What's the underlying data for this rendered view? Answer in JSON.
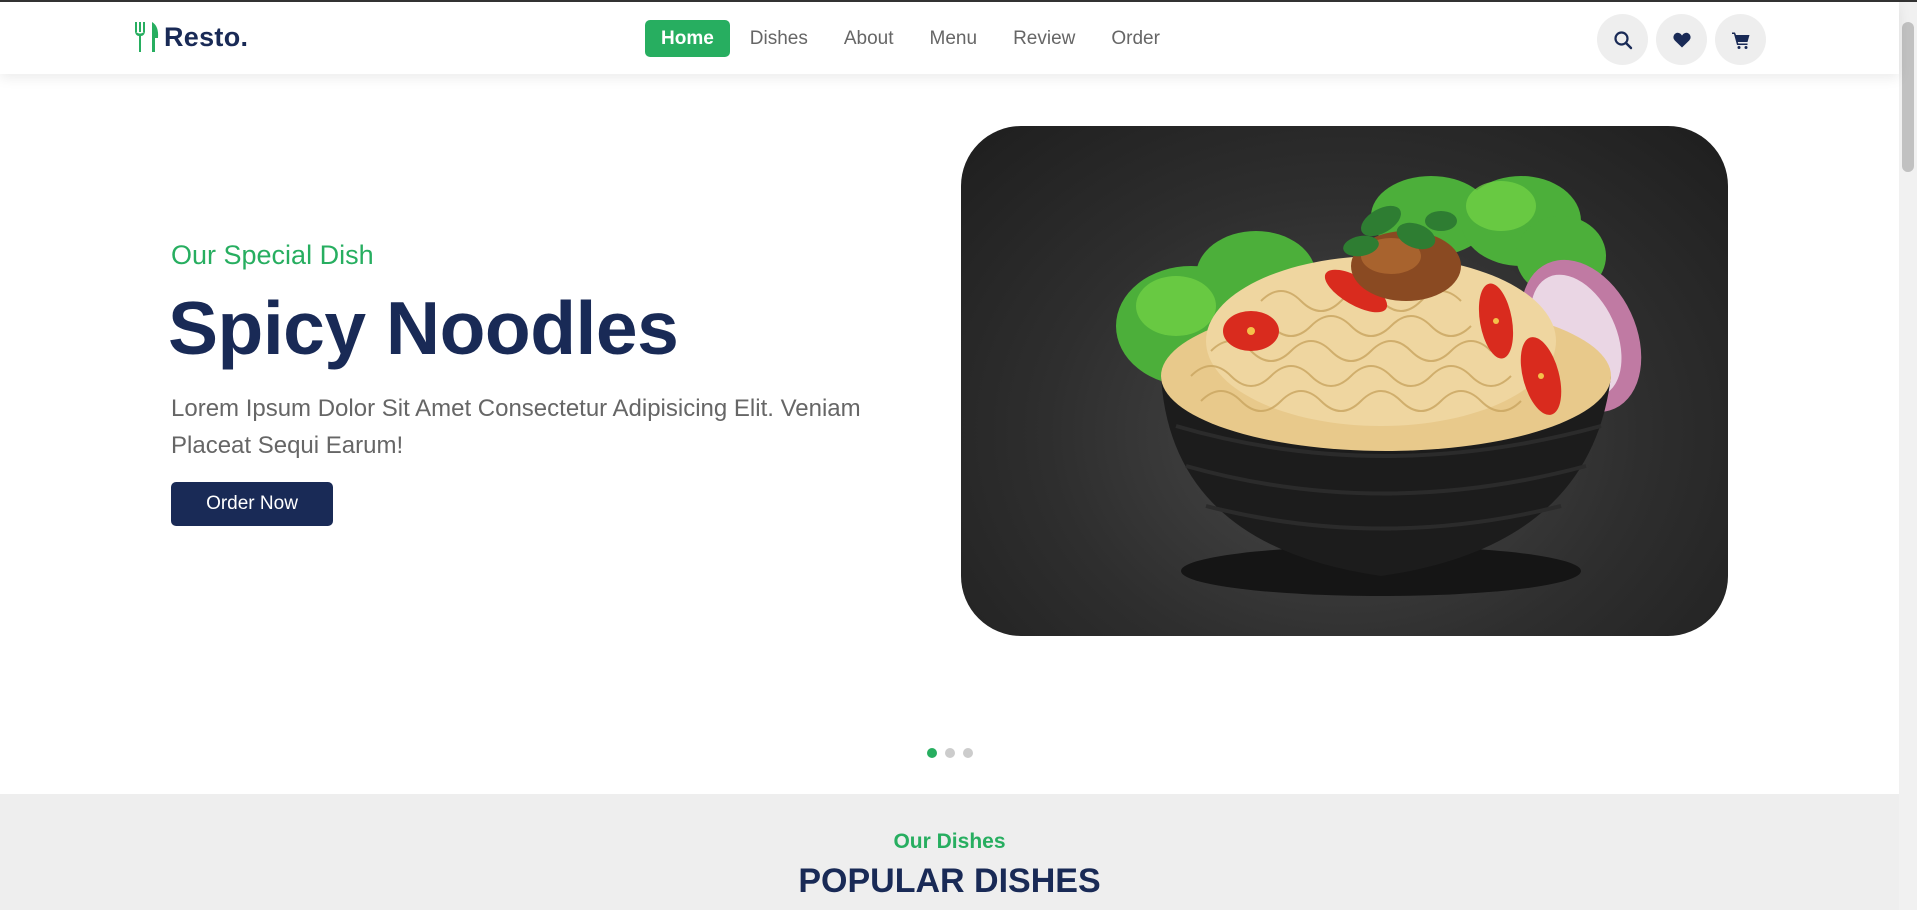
{
  "header": {
    "logo_text": "Resto.",
    "nav": [
      {
        "label": "Home",
        "active": true
      },
      {
        "label": "Dishes",
        "active": false
      },
      {
        "label": "About",
        "active": false
      },
      {
        "label": "Menu",
        "active": false
      },
      {
        "label": "Review",
        "active": false
      },
      {
        "label": "Order",
        "active": false
      }
    ],
    "icons": [
      "search-icon",
      "heart-icon",
      "cart-icon"
    ]
  },
  "hero": {
    "subtitle": "Our Special Dish",
    "title": "Spicy Noodles",
    "description": "Lorem Ipsum Dolor Sit Amet Consectetur Adipisicing Elit. Veniam Placeat Sequi Earum!",
    "button_label": "Order Now",
    "slides_count": 3,
    "active_slide": 1
  },
  "dishes_section": {
    "subtitle": "Our Dishes",
    "title": "POPULAR DISHES"
  },
  "colors": {
    "brand_green": "#27ae60",
    "brand_navy": "#192a56",
    "text_gray": "#666666",
    "section_bg": "#eeeeee"
  }
}
